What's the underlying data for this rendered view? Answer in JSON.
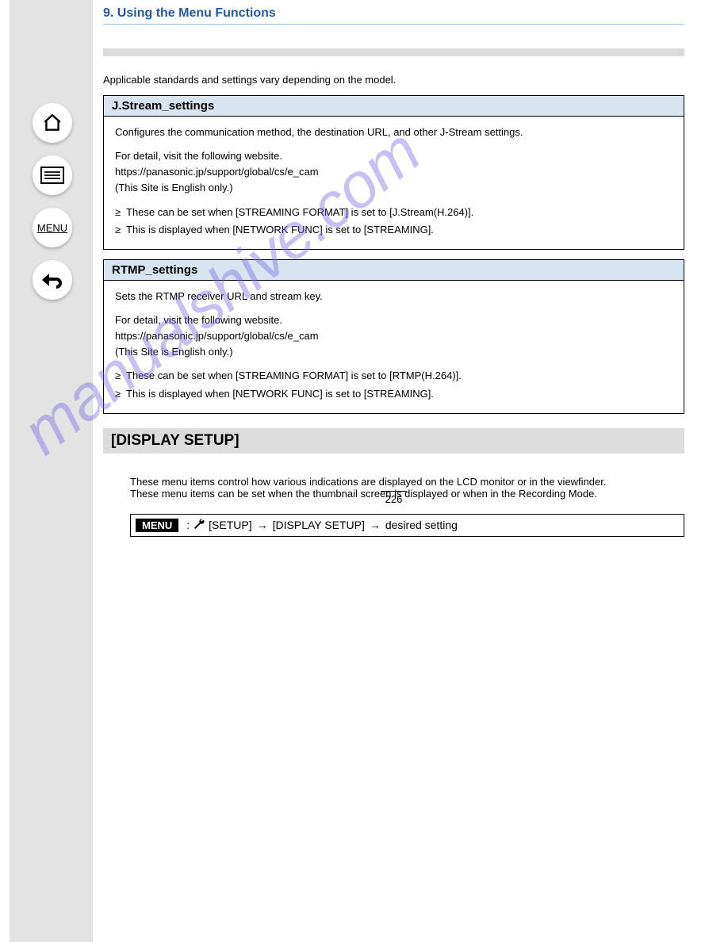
{
  "sidebar": {
    "menu_label": "MENU"
  },
  "header": {
    "section_number": "9.",
    "section_title": "Using the Menu Functions"
  },
  "intro_text": "Applicable standards and settings vary depending on the model.",
  "jstream": {
    "title": "J.Stream_settings",
    "body": "Configures the communication method, the destination URL, and other J-Stream settings.",
    "hint_prefix": "For detail, visit the following website.",
    "url": "https://panasonic.jp/support/global/cs/e_cam",
    "note": "(This Site is English only.)",
    "bullets": [
      "These can be set when [STREAMING FORMAT] is set to [J.Stream(H.264)].",
      "This is displayed when [NETWORK FUNC] is set to [STREAMING]."
    ]
  },
  "rtmp": {
    "title": "RTMP_settings",
    "body": "Sets the RTMP receiver URL and stream key.",
    "hint_prefix": "For detail, visit the following website.",
    "url": "https://panasonic.jp/support/global/cs/e_cam",
    "note": "(This Site is English only.)",
    "bullets": [
      "These can be set when [STREAMING FORMAT] is set to [RTMP(H.264)].",
      "This is displayed when [NETWORK FUNC] is set to [STREAMING]."
    ]
  },
  "display_section": {
    "title": "[DISPLAY SETUP]",
    "intro_part1": "These menu items control how various indications are displayed on the LCD monitor or in the viewfinder.",
    "intro_part2": "These menu items can be set when the thumbnail screen is displayed or when in the Recording Mode.",
    "menu_tag": "MENU",
    "colon": ":",
    "arrow": "→",
    "setup_label": "[SETUP]",
    "display_label": "[DISPLAY SETUP]",
    "desired_label": "desired setting"
  },
  "page_number": "226",
  "watermark": "manualshive.com"
}
